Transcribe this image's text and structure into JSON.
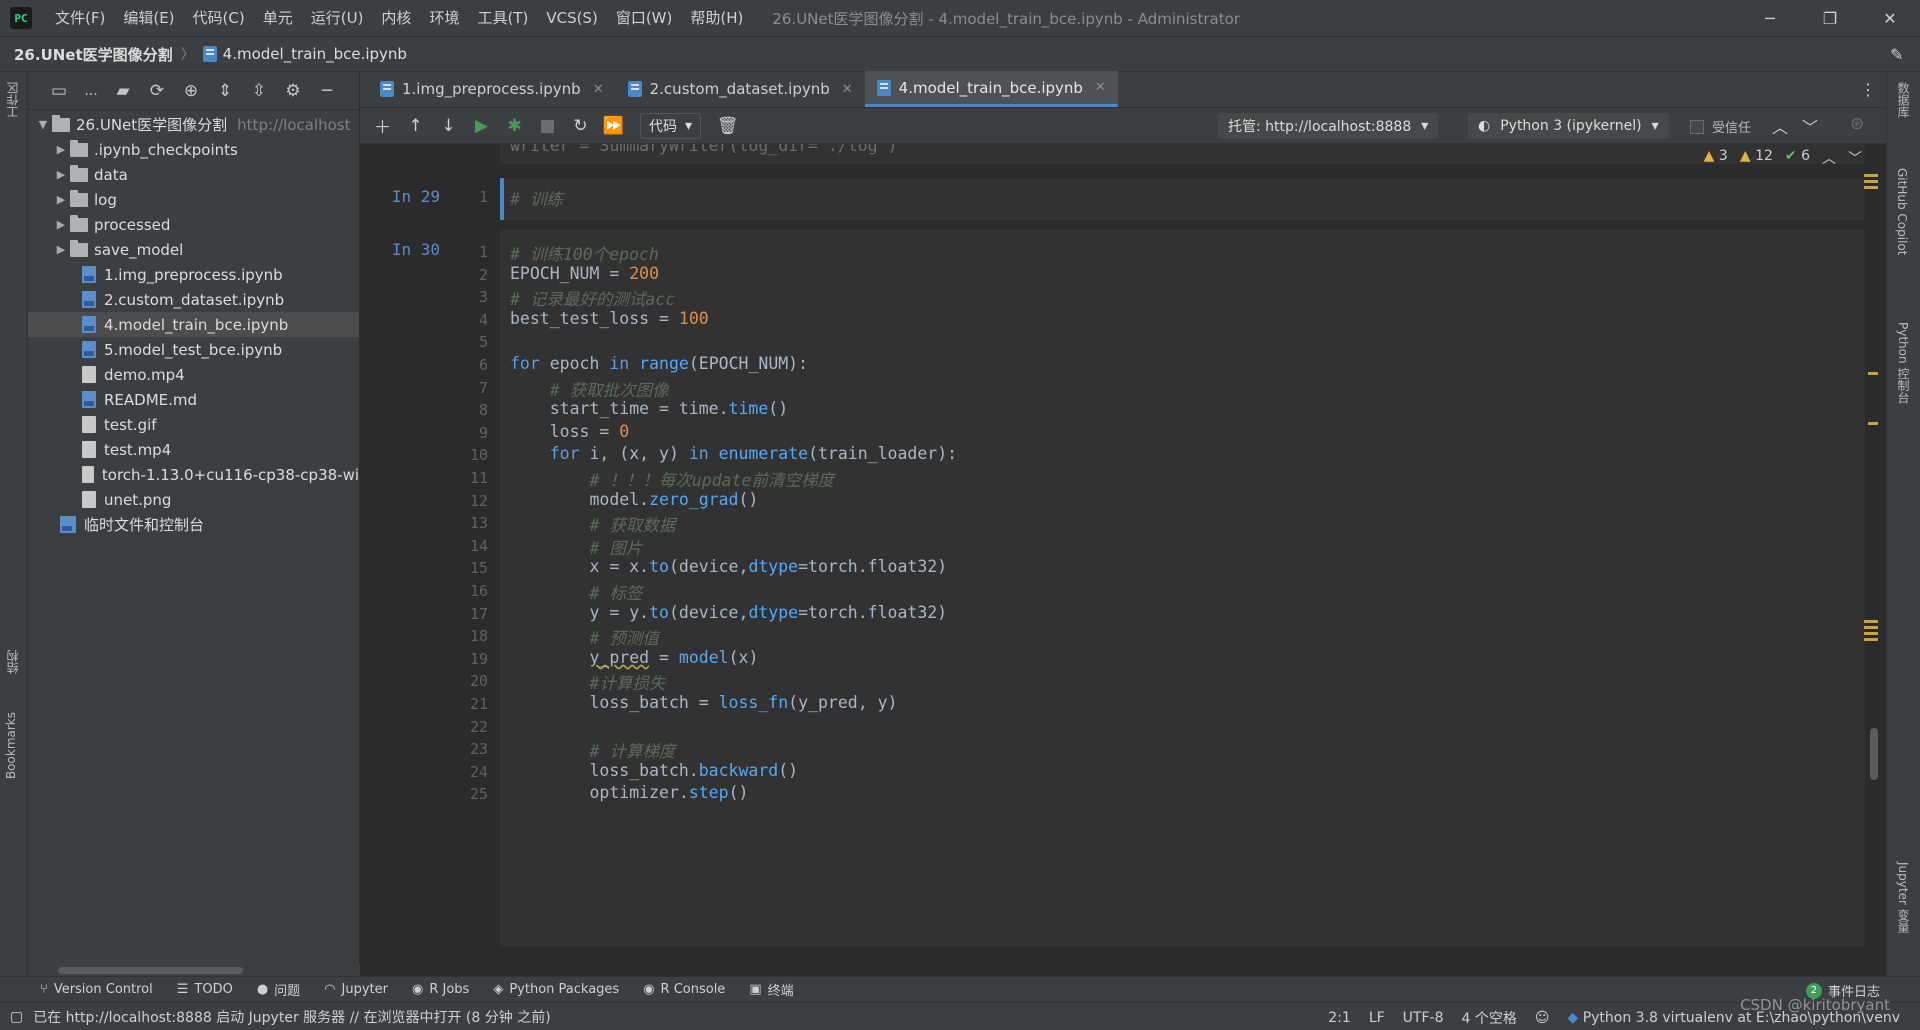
{
  "app": {
    "logo_text": "PC",
    "menu": [
      "文件(F)",
      "编辑(E)",
      "代码(C)",
      "单元",
      "运行(U)",
      "内核",
      "环境",
      "工具(T)",
      "VCS(S)",
      "窗口(W)",
      "帮助(H)"
    ],
    "window_title": "26.UNet医学图像分割 - 4.model_train_bce.ipynb - Administrator",
    "win_controls": [
      "─",
      "❐",
      "✕"
    ]
  },
  "breadcrumb": {
    "project": "26.UNet医学图像分割",
    "file": "4.model_train_bce.ipynb"
  },
  "left_strip": {
    "top_label": "工作区",
    "structure_label": "结构",
    "bookmarks_label": "Bookmarks"
  },
  "project_panel": {
    "toolbar_dots": "...",
    "root_name": "26.UNet医学图像分割",
    "root_url": "http://localhost",
    "folders": [
      ".ipynb_checkpoints",
      "data",
      "log",
      "processed",
      "save_model"
    ],
    "files": [
      {
        "name": "1.img_preprocess.ipynb",
        "type": "notebook"
      },
      {
        "name": "2.custom_dataset.ipynb",
        "type": "notebook"
      },
      {
        "name": "4.model_train_bce.ipynb",
        "type": "notebook",
        "selected": true
      },
      {
        "name": "5.model_test_bce.ipynb",
        "type": "notebook"
      },
      {
        "name": "demo.mp4",
        "type": "file"
      },
      {
        "name": "README.md",
        "type": "file"
      },
      {
        "name": "test.gif",
        "type": "file"
      },
      {
        "name": "test.mp4",
        "type": "file"
      },
      {
        "name": "torch-1.13.0+cu116-cp38-cp38-wi",
        "type": "file"
      },
      {
        "name": "unet.png",
        "type": "file"
      }
    ],
    "scratches": "临时文件和控制台"
  },
  "tabs": [
    {
      "label": "1.img_preprocess.ipynb",
      "active": false
    },
    {
      "label": "2.custom_dataset.ipynb",
      "active": false
    },
    {
      "label": "4.model_train_bce.ipynb",
      "active": true
    }
  ],
  "nb_toolbar": {
    "cell_type": "代码",
    "host": "托管: http://localhost:8888",
    "kernel": "Python 3 (ipykernel)",
    "trusted": "受信任"
  },
  "inspections": {
    "warn1": "3",
    "warn2": "12",
    "ok": "6"
  },
  "cells": {
    "cell29": {
      "label": "In 29",
      "lines": [
        {
          "n": "1"
        }
      ],
      "text": "# 训练"
    },
    "cell30": {
      "label": "In 30"
    }
  },
  "right_strip": {
    "database": "数据库",
    "copilot": "GitHub Copilot",
    "python_console": "Python 控制台",
    "jupyter": "Jupyter 变量"
  },
  "bottom_tools": [
    "Version Control",
    "TODO",
    "问题",
    "Jupyter",
    "R Jobs",
    "Python Packages",
    "R Console",
    "终端"
  ],
  "event_log": {
    "label": "事件日志",
    "count": "2"
  },
  "status": {
    "message": "已在 http://localhost:8888 启动 Jupyter 服务器 // 在浏览器中打开 (8 分钟 之前)",
    "position": "2:1",
    "line_sep": "LF",
    "encoding": "UTF-8",
    "indent": "4 个空格",
    "interpreter": "Python 3.8 virtualenv at E:\\zhao\\python\\venv"
  },
  "watermark": "CSDN @kiritobryant"
}
